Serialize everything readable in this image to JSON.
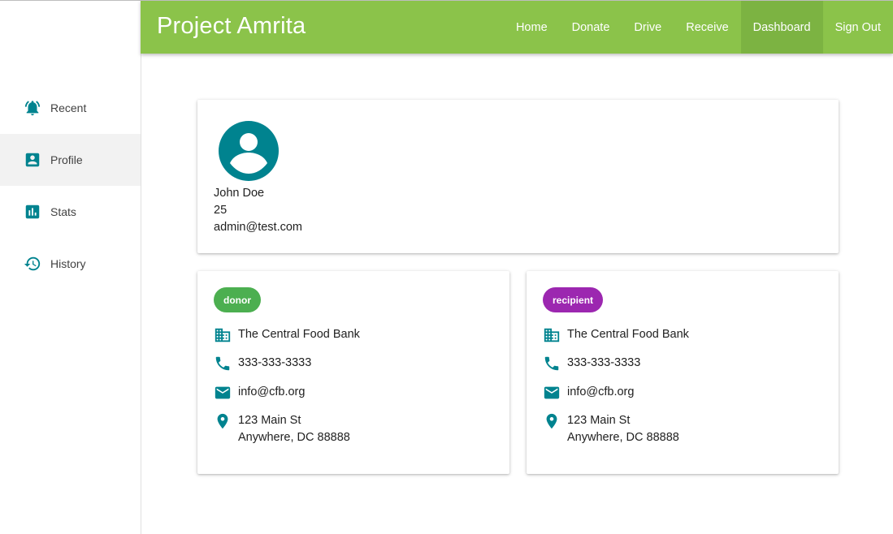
{
  "app": {
    "title": "Project Amrita"
  },
  "colors": {
    "accent": "#8bc34a",
    "accent_dark": "#7cb342",
    "icon": "#00838f",
    "donor": "#4caf50",
    "recipient": "#9c27b0"
  },
  "nav": {
    "items": [
      {
        "label": "Home"
      },
      {
        "label": "Donate"
      },
      {
        "label": "Drive"
      },
      {
        "label": "Receive"
      },
      {
        "label": "Dashboard",
        "active": true
      },
      {
        "label": "Sign Out"
      }
    ]
  },
  "sidebar": {
    "items": [
      {
        "label": "Recent",
        "icon": "bell-icon"
      },
      {
        "label": "Profile",
        "icon": "account-box-icon",
        "active": true
      },
      {
        "label": "Stats",
        "icon": "bar-chart-icon"
      },
      {
        "label": "History",
        "icon": "history-icon"
      }
    ]
  },
  "profile": {
    "name": "John Doe",
    "age": "25",
    "email": "admin@test.com"
  },
  "orgs": [
    {
      "role": "donor",
      "name": "The Central Food Bank",
      "phone": "333-333-3333",
      "email": "info@cfb.org",
      "address_line1": "123 Main St",
      "address_line2": "Anywhere, DC 88888"
    },
    {
      "role": "recipient",
      "name": "The Central Food Bank",
      "phone": "333-333-3333",
      "email": "info@cfb.org",
      "address_line1": "123 Main St",
      "address_line2": "Anywhere, DC 88888"
    }
  ]
}
